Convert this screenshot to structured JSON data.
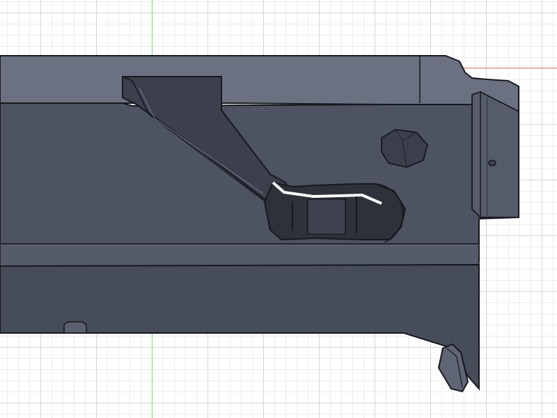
{
  "canvas": {
    "grid_color": "#d6d6d6",
    "grid_minor_color": "#ececec",
    "axis_y_color": "#7ad07a",
    "axis_x_color": "#f08c8c",
    "body_color": "#4f5563",
    "body_dark_color": "#3c414d",
    "body_top_color": "#6e7484",
    "edge_color": "#16181d",
    "highlight_color": "#ffffff"
  },
  "scene": {
    "object": "receiver-body",
    "features": [
      "hex-boss",
      "trigger-slot",
      "ejection-ramp",
      "pin-hole",
      "notch-tab",
      "hinge-lug"
    ]
  }
}
